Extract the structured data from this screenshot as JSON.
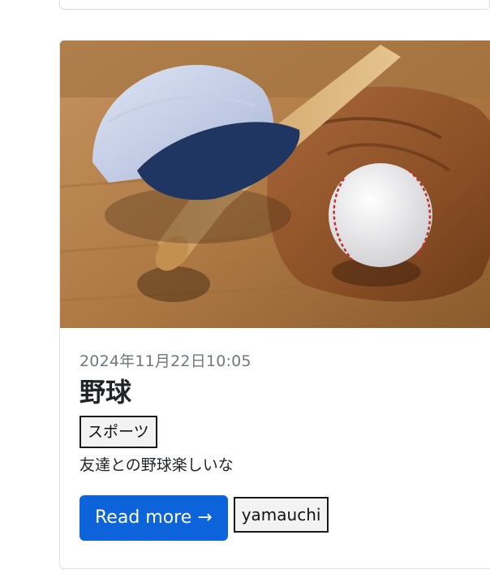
{
  "post": {
    "image_alt": "baseball cap, bat, glove and ball",
    "date": "2024年11月22日10:05",
    "title": "野球",
    "category": "スポーツ",
    "body": "友達との野球楽しいな",
    "read_more_label": "Read more →",
    "author": "yamauchi"
  },
  "colors": {
    "primary_button": "#0d63d9",
    "date_text": "#707880",
    "title_text": "#212529"
  }
}
